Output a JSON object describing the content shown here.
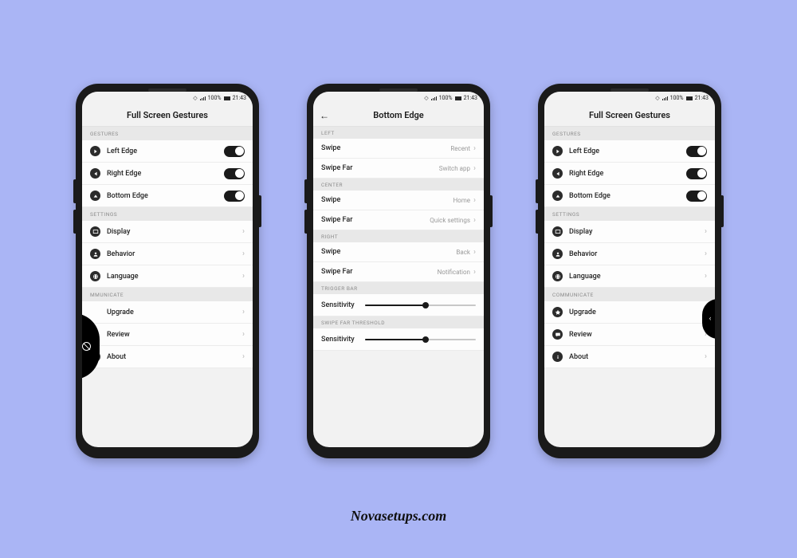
{
  "footer": "Novasetups.com",
  "status": {
    "battery_pct": "100%",
    "time": "21:43"
  },
  "phone1": {
    "title": "Full Screen Gestures",
    "sections": {
      "gestures": {
        "header": "GESTURES",
        "items": [
          {
            "label": "Left Edge",
            "toggle": true
          },
          {
            "label": "Right Edge",
            "toggle": true
          },
          {
            "label": "Bottom Edge",
            "toggle": true
          }
        ]
      },
      "settings": {
        "header": "SETTINGS",
        "items": [
          {
            "label": "Display"
          },
          {
            "label": "Behavior"
          },
          {
            "label": "Language"
          }
        ]
      },
      "communicate": {
        "header": "MMUNICATE",
        "items": [
          {
            "label": "Upgrade"
          },
          {
            "label": "Review"
          },
          {
            "label": "About"
          }
        ]
      }
    }
  },
  "phone2": {
    "title": "Bottom Edge",
    "sections": {
      "left": {
        "header": "LEFT",
        "items": [
          {
            "label": "Swipe",
            "value": "Recent"
          },
          {
            "label": "Swipe Far",
            "value": "Switch app"
          }
        ]
      },
      "center": {
        "header": "CENTER",
        "items": [
          {
            "label": "Swipe",
            "value": "Home"
          },
          {
            "label": "Swipe Far",
            "value": "Quick settings"
          }
        ]
      },
      "right": {
        "header": "RIGHT",
        "items": [
          {
            "label": "Swipe",
            "value": "Back"
          },
          {
            "label": "Swipe Far",
            "value": "Notification"
          }
        ]
      },
      "trigger": {
        "header": "TRIGGER BAR",
        "slider_label": "Sensitivity",
        "slider_value": 0.55
      },
      "swipefar": {
        "header": "SWIPE FAR THRESHOLD",
        "slider_label": "Sensitivity",
        "slider_value": 0.55
      }
    }
  },
  "phone3": {
    "title": "Full Screen Gestures",
    "sections": {
      "gestures": {
        "header": "GESTURES",
        "items": [
          {
            "label": "Left Edge",
            "toggle": true
          },
          {
            "label": "Right Edge",
            "toggle": true
          },
          {
            "label": "Bottom Edge",
            "toggle": true
          }
        ]
      },
      "settings": {
        "header": "SETTINGS",
        "items": [
          {
            "label": "Display"
          },
          {
            "label": "Behavior"
          },
          {
            "label": "Language"
          }
        ]
      },
      "communicate": {
        "header": "COMMUNICATE",
        "items": [
          {
            "label": "Upgrade"
          },
          {
            "label": "Review"
          },
          {
            "label": "About"
          }
        ]
      }
    }
  }
}
